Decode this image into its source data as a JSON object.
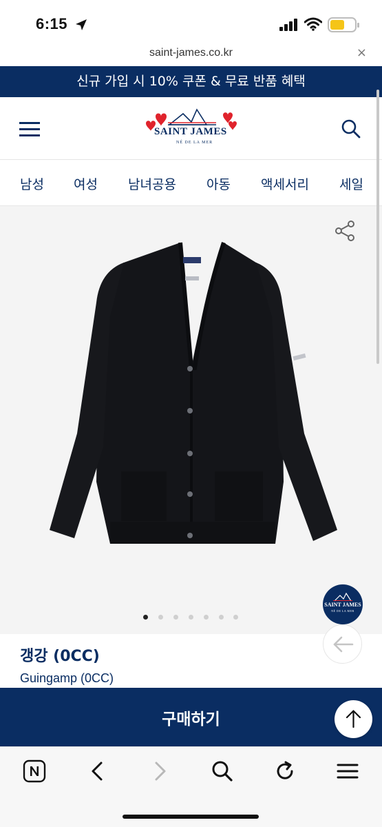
{
  "status_bar": {
    "time": "6:15",
    "location_icon": "location-arrow-icon",
    "signal_icon": "cellular-signal-icon",
    "wifi_icon": "wifi-icon",
    "battery_icon": "battery-icon",
    "battery_color": "#f5c518"
  },
  "browser": {
    "url": "saint-james.co.kr",
    "close_label": "×"
  },
  "promo": {
    "text": "신규 가입 시 10% 쿠폰 & 무료 반품 혜택",
    "background": "#0a2d62"
  },
  "header": {
    "logo_text": "SAINT JAMES",
    "logo_tagline": "NÉ DE LA MER",
    "menu_icon": "hamburger-menu-icon",
    "search_icon": "search-icon",
    "brand_color": "#0a2d62",
    "heart_color": "#e0232c"
  },
  "categories": [
    "남성",
    "여성",
    "남녀공용",
    "아동",
    "액세서리",
    "세일"
  ],
  "product": {
    "image_icon": "cardigan-image",
    "share_icon": "share-icon",
    "carousel_dots": 7,
    "active_dot": 1,
    "name_ko": "갱강 (0CC)",
    "name_en": "Guingamp (0CC)",
    "round_logo_text": "SAINT JAMES",
    "round_logo_tagline": "NÉ DE LA MER"
  },
  "buy": {
    "label": "구매하기"
  },
  "floating": {
    "back_icon": "arrow-left-icon",
    "top_icon": "arrow-up-icon"
  },
  "toolbar": {
    "items": [
      "naver-home-icon",
      "back-icon",
      "forward-icon",
      "search-icon",
      "reload-icon",
      "menu-icon"
    ]
  }
}
